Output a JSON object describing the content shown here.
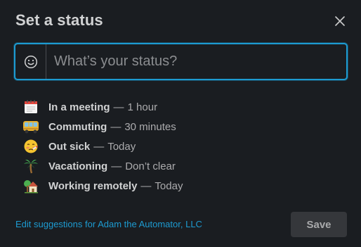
{
  "modal": {
    "title": "Set a status",
    "close_icon": "close-icon"
  },
  "status_input": {
    "placeholder": "What’s your status?",
    "value": "",
    "emoji_icon": "smiley-face-icon"
  },
  "suggestions": [
    {
      "icon": "calendar-icon",
      "label": "In a meeting",
      "separator": "—",
      "duration": "1 hour"
    },
    {
      "icon": "bus-icon",
      "label": "Commuting",
      "separator": "—",
      "duration": "30 minutes"
    },
    {
      "icon": "sick-face-icon",
      "label": "Out sick",
      "separator": "—",
      "duration": "Today"
    },
    {
      "icon": "palm-tree-icon",
      "label": "Vacationing",
      "separator": "—",
      "duration": "Don’t clear"
    },
    {
      "icon": "house-icon",
      "label": "Working remotely",
      "separator": "—",
      "duration": "Today"
    }
  ],
  "footer": {
    "edit_link": "Edit suggestions for Adam the Automator, LLC",
    "save_label": "Save"
  },
  "colors": {
    "background": "#1a1d21",
    "accent": "#1d9bd1",
    "text": "#d1d2d3",
    "save_button_bg": "#35373b"
  }
}
